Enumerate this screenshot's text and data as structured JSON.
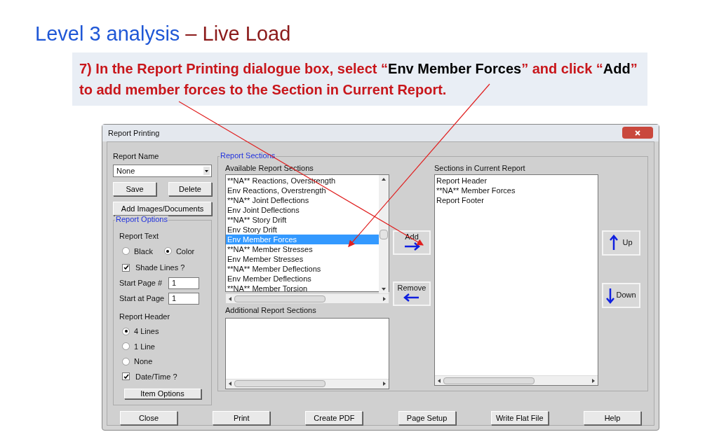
{
  "slide": {
    "title": "Level 3 analysis",
    "title_suffix": "– Live Load"
  },
  "instruction": [
    {
      "text": "7) In the Report Printing dialogue box, select “",
      "kind": "plain"
    },
    {
      "text": "Env Member Forces",
      "kind": "quote"
    },
    {
      "text": "” and click “",
      "kind": "plain"
    },
    {
      "text": "Add",
      "kind": "quote"
    },
    {
      "text": "” to add member forces to the Section in Current Report.",
      "kind": "plain"
    }
  ],
  "dialog": {
    "title": "Report Printing",
    "report_name": {
      "label": "Report Name",
      "value": "None"
    },
    "name_buttons": [
      "Save",
      "Delete"
    ],
    "add_images_button": "Add Images/Documents",
    "report_options": {
      "title": "Report Options",
      "report_text_label": "Report Text",
      "report_text": [
        {
          "label": "Black",
          "selected": false
        },
        {
          "label": "Color",
          "selected": true
        }
      ],
      "shade_lines": {
        "label": "Shade Lines ?",
        "checked": true
      },
      "start_page_number": {
        "label": "Start Page #",
        "value": "1"
      },
      "start_at_page": {
        "label": "Start at Page",
        "value": "1"
      },
      "report_header_label": "Report Header",
      "report_header": [
        {
          "label": "4 Lines",
          "selected": true
        },
        {
          "label": "1 Line",
          "selected": false
        },
        {
          "label": "None",
          "selected": false
        }
      ],
      "date_time": {
        "label": "Date/Time ?",
        "checked": true
      },
      "item_options_button": "Item Options"
    },
    "report_sections": {
      "title": "Report Sections",
      "available_label": "Available Report Sections",
      "available": [
        {
          "label": "**NA** Reactions, Overstrength",
          "selected": false
        },
        {
          "label": "Env Reactions, Overstrength",
          "selected": false
        },
        {
          "label": "**NA** Joint Deflections",
          "selected": false
        },
        {
          "label": "Env Joint Deflections",
          "selected": false
        },
        {
          "label": "**NA** Story Drift",
          "selected": false
        },
        {
          "label": "Env Story Drift",
          "selected": false
        },
        {
          "label": "Env Member Forces",
          "selected": true
        },
        {
          "label": "**NA** Member Stresses",
          "selected": false
        },
        {
          "label": "Env Member Stresses",
          "selected": false
        },
        {
          "label": "**NA** Member Deflections",
          "selected": false
        },
        {
          "label": "Env Member Deflections",
          "selected": false
        },
        {
          "label": "**NA** Member Torsion",
          "selected": false
        }
      ],
      "additional_label": "Additional Report Sections",
      "add_button": "Add",
      "remove_button": "Remove",
      "current_label": "Sections in Current Report",
      "current": [
        "Report Header",
        "**NA** Member Forces",
        "Report Footer"
      ],
      "up_button": "Up",
      "down_button": "Down"
    },
    "bottom_buttons": [
      "Close",
      "Print",
      "Create PDF",
      "Page Setup",
      "Write Flat File",
      "Help"
    ]
  }
}
